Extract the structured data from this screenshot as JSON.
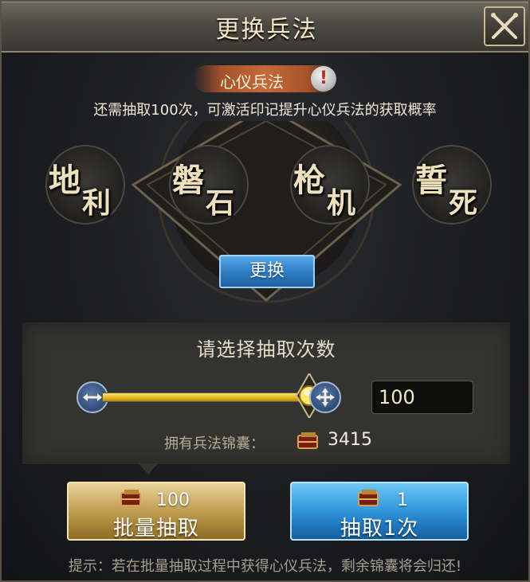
{
  "window": {
    "title": "更换兵法",
    "close_icon": "close-x-icon"
  },
  "badge": {
    "label": "心仪兵法",
    "warning_icon_glyph": "!"
  },
  "hint_top": "还需抽取100次，可激活印记提升心仪兵法的获取概率",
  "seals": [
    {
      "char1": "地",
      "char2": "利"
    },
    {
      "char1": "磐",
      "char2": "石"
    },
    {
      "char1": "枪",
      "char2": "机"
    },
    {
      "char1": "誓",
      "char2": "死"
    }
  ],
  "change_button": "更换",
  "selection": {
    "title": "请选择抽取次数",
    "slider_fraction": 1.0,
    "count_value": "100",
    "own_label": "拥有兵法锦囊：",
    "own_value": "3415"
  },
  "batch_button": {
    "cost": "100",
    "label": "批量抽取"
  },
  "single_button": {
    "cost": "1",
    "label": "抽取1次"
  },
  "footer_tip": "提示：若在批量抽取过程中获得心仪兵法，剩余锦囊将会归还!",
  "colors": {
    "accent_gold": "#e2b21d",
    "button_blue": "#2e7fc6",
    "badge_orange": "#c46a39"
  }
}
